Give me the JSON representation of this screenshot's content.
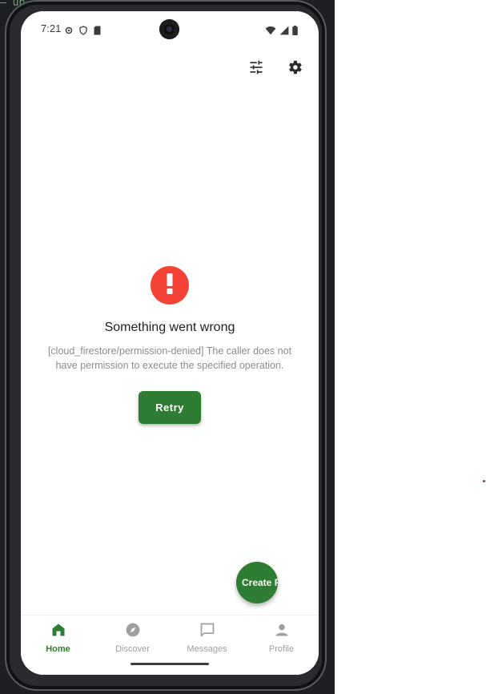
{
  "status_bar": {
    "time": "7:21",
    "left_icons": [
      "settings-gear-icon",
      "shield-icon",
      "sd-card-icon"
    ],
    "right_icons": [
      "wifi-icon",
      "cellular-signal-icon",
      "battery-icon"
    ]
  },
  "top_actions": {
    "filter_icon": "tune-sliders-icon",
    "settings_icon": "gear-icon"
  },
  "error": {
    "icon": "exclamation-icon",
    "title": "Something went wrong",
    "message": "[cloud_firestore/permission-denied] The caller does not have permission to execute the specified operation.",
    "retry_label": "Retry"
  },
  "fab": {
    "label": "Create P"
  },
  "bottom_nav": {
    "items": [
      {
        "label": "Home",
        "icon": "home-icon",
        "active": true
      },
      {
        "label": "Discover",
        "icon": "compass-icon",
        "active": false
      },
      {
        "label": "Messages",
        "icon": "chat-bubble-icon",
        "active": false
      },
      {
        "label": "Profile",
        "icon": "person-icon",
        "active": false
      }
    ]
  },
  "colors": {
    "accent": "#2e7d32",
    "error": "#f44336",
    "inactive": "#9e9e9e"
  }
}
